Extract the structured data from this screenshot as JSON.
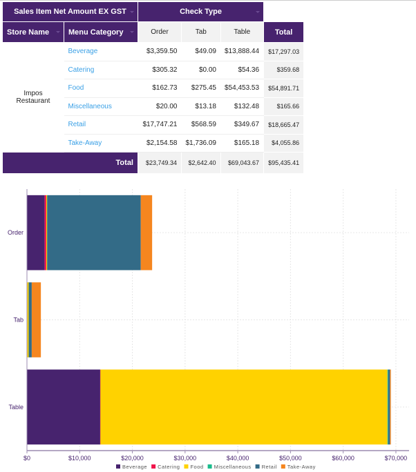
{
  "pivot": {
    "measure_header": "Sales Item Net Amount EX GST",
    "column_dim_header": "Check Type",
    "row_headers": [
      "Store Name",
      "Menu Category"
    ],
    "columns": [
      "Order",
      "Tab",
      "Table"
    ],
    "total_label": "Total",
    "store": "Impos Restaurant",
    "rows": [
      {
        "category": "Beverage",
        "values": [
          "$3,359.50",
          "$49.09",
          "$13,888.44"
        ],
        "total": "$17,297.03"
      },
      {
        "category": "Catering",
        "values": [
          "$305.32",
          "$0.00",
          "$54.36"
        ],
        "total": "$359.68"
      },
      {
        "category": "Food",
        "values": [
          "$162.73",
          "$275.45",
          "$54,453.53"
        ],
        "total": "$54,891.71"
      },
      {
        "category": "Miscellaneous",
        "values": [
          "$20.00",
          "$13.18",
          "$132.48"
        ],
        "total": "$165.66"
      },
      {
        "category": "Retail",
        "values": [
          "$17,747.21",
          "$568.59",
          "$349.67"
        ],
        "total": "$18,665.47"
      },
      {
        "category": "Take-Away",
        "values": [
          "$2,154.58",
          "$1,736.09",
          "$165.18"
        ],
        "total": "$4,055.86"
      }
    ],
    "totals": [
      "$23,749.34",
      "$2,642.40",
      "$69,043.67"
    ],
    "grand_total": "$95,435.41"
  },
  "chart_data": {
    "type": "bar",
    "orientation": "horizontal",
    "stacked": true,
    "categories": [
      "Order",
      "Tab",
      "Table"
    ],
    "series": [
      {
        "name": "Beverage",
        "color": "#47236e",
        "values": [
          3359.5,
          49.09,
          13888.44
        ]
      },
      {
        "name": "Catering",
        "color": "#f0144b",
        "values": [
          305.32,
          0,
          54.36
        ]
      },
      {
        "name": "Food",
        "color": "#ffd200",
        "values": [
          162.73,
          275.45,
          54453.53
        ]
      },
      {
        "name": "Miscellaneous",
        "color": "#1abc8c",
        "values": [
          20.0,
          13.18,
          132.48
        ]
      },
      {
        "name": "Retail",
        "color": "#336b87",
        "values": [
          17747.21,
          568.59,
          349.67
        ]
      },
      {
        "name": "Take-Away",
        "color": "#f5861f",
        "values": [
          2154.58,
          1736.09,
          165.18
        ]
      }
    ],
    "xticks": [
      "$0",
      "$10,000",
      "$20,000",
      "$30,000",
      "$40,000",
      "$50,000",
      "$60,000",
      "$70,000"
    ],
    "xlim": [
      0,
      72500
    ],
    "grid": true,
    "legend": "bottom"
  }
}
